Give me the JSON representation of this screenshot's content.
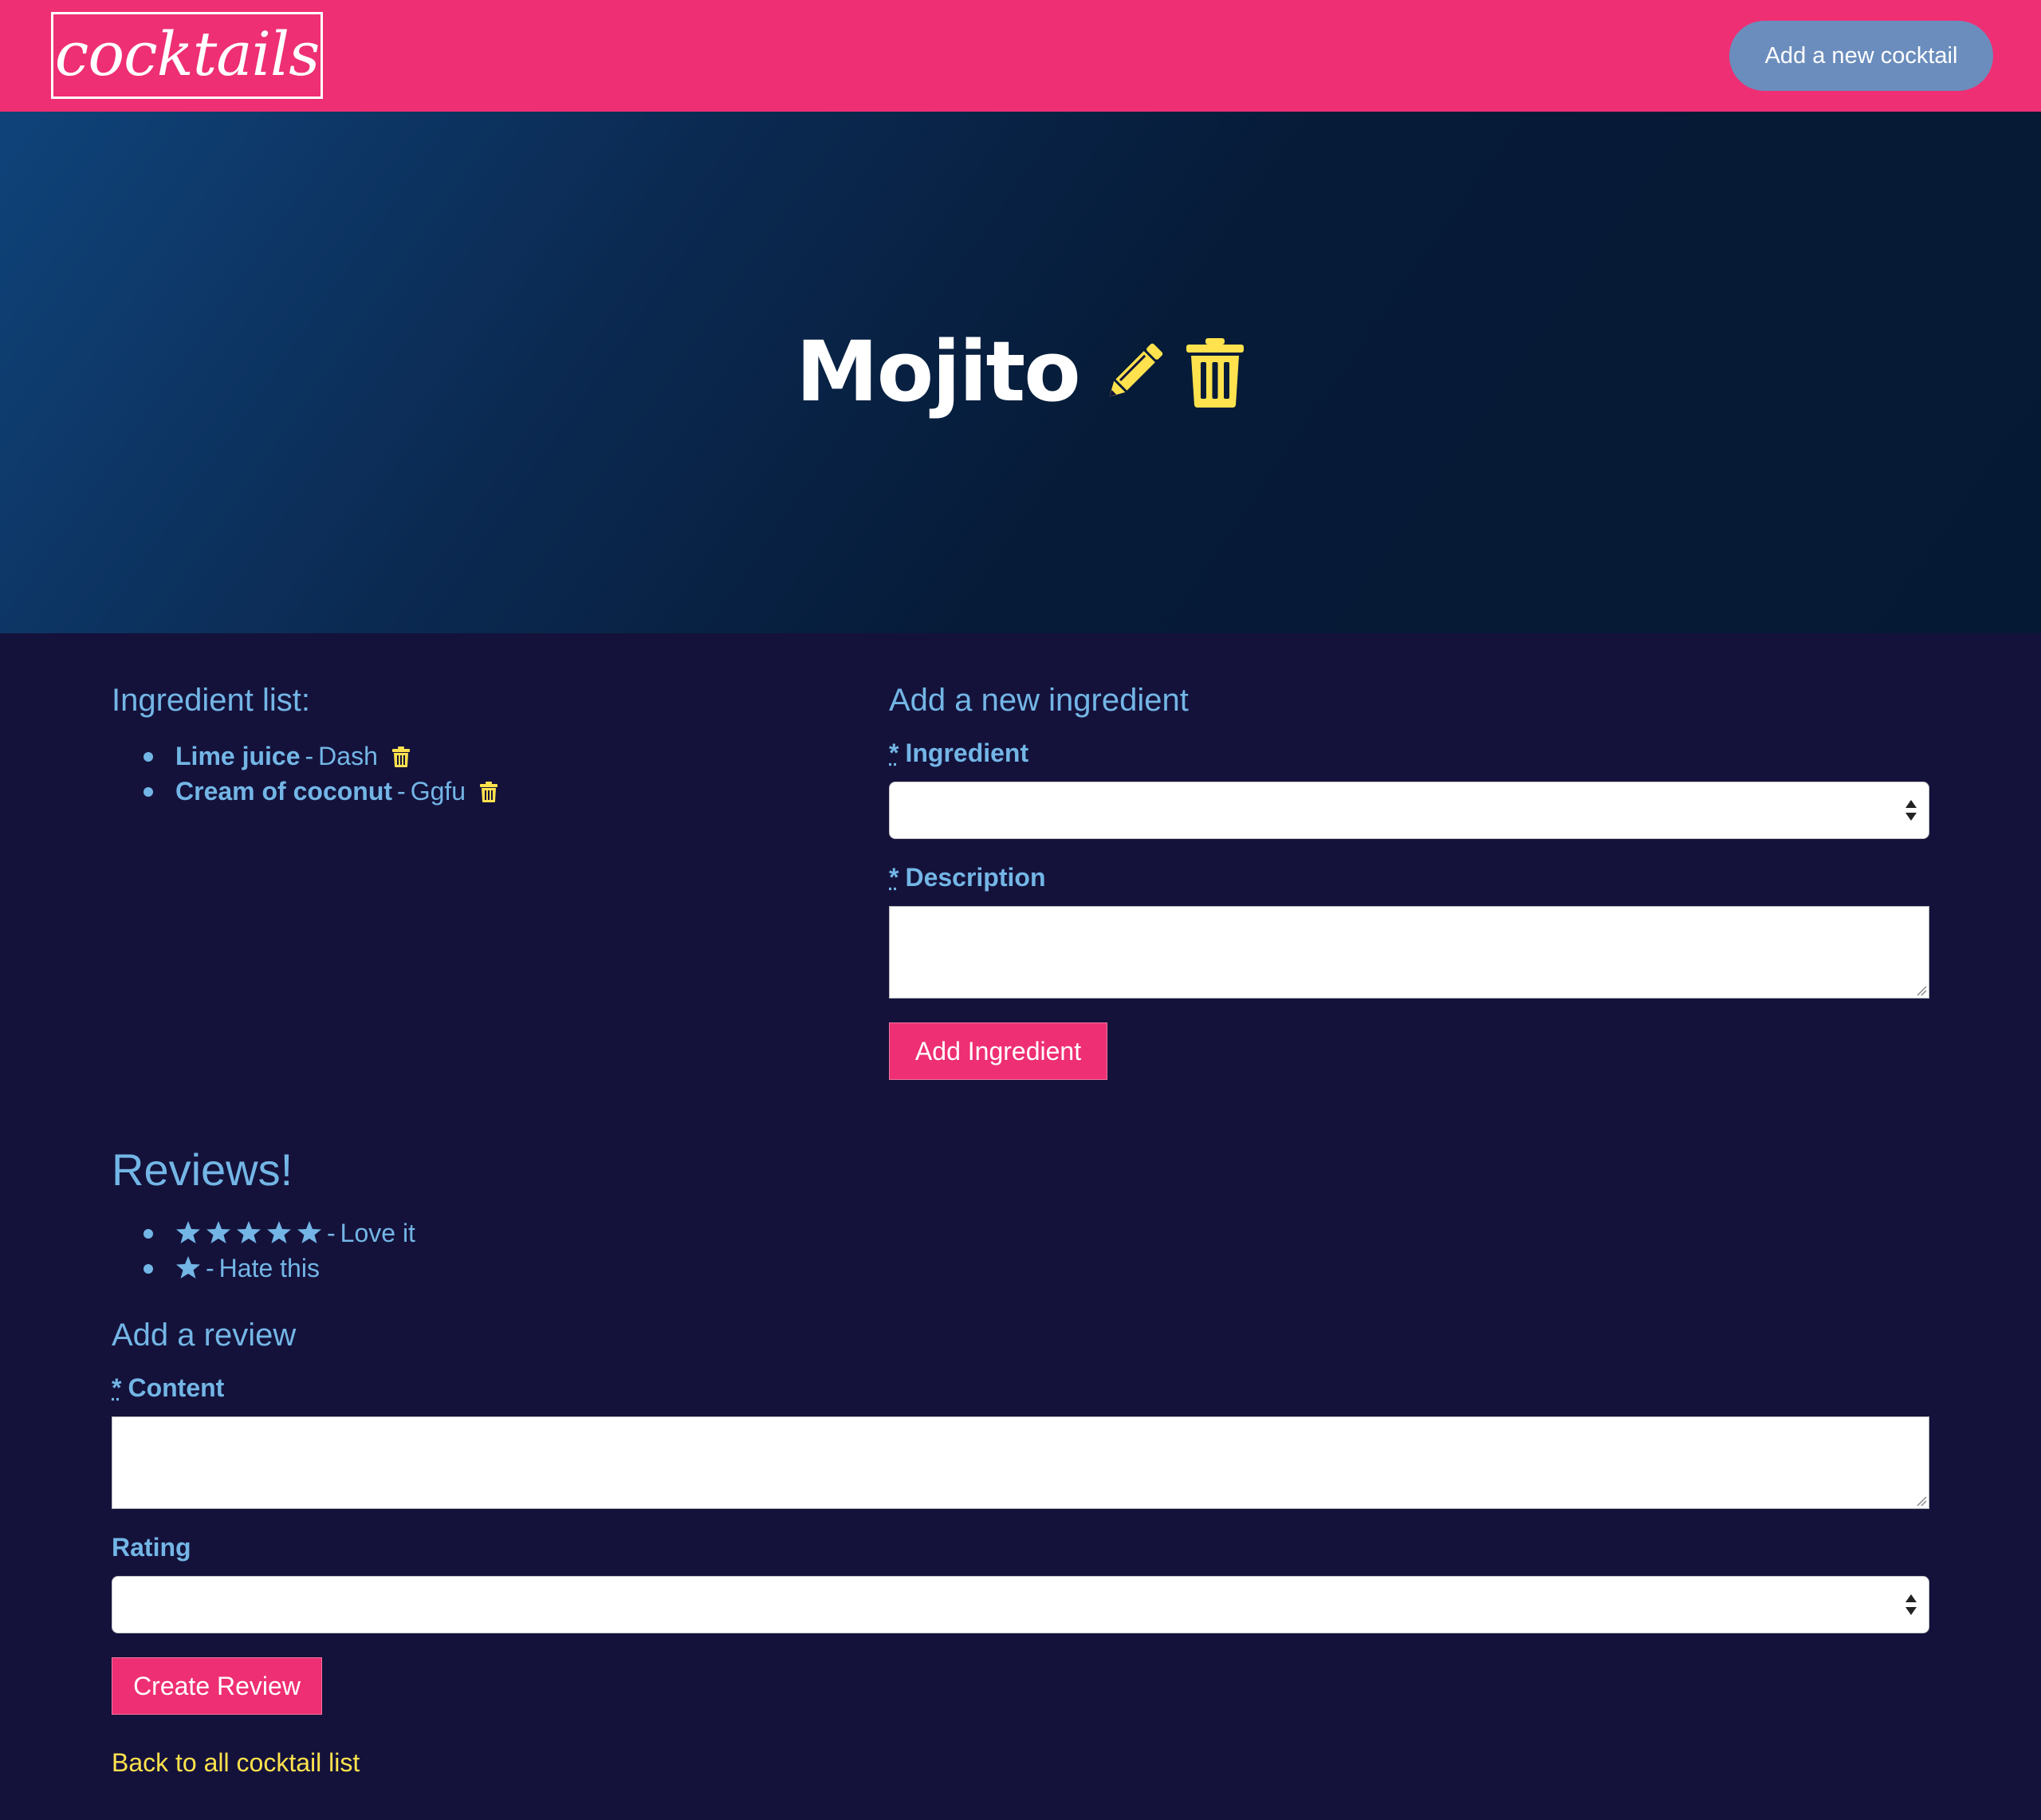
{
  "navbar": {
    "logo_text": "cocktails",
    "add_cocktail_label": "Add a new cocktail",
    "background_color": "#ee2f73"
  },
  "cocktail": {
    "name": "Mojito",
    "edit_icon": "pencil-icon",
    "delete_icon": "trash-icon"
  },
  "ingredients": {
    "heading": "Ingredient list:",
    "items": [
      {
        "name": "Lime juice",
        "description": "Dash"
      },
      {
        "name": "Cream of coconut",
        "description": "Ggfu"
      }
    ]
  },
  "add_ingredient_form": {
    "heading": "Add a new ingredient",
    "required_marker": "*",
    "ingredient_label": "Ingredient",
    "ingredient_value": "",
    "description_label": "Description",
    "description_value": "",
    "submit_label": "Add Ingredient"
  },
  "reviews": {
    "heading": "Reviews!",
    "items": [
      {
        "stars": 5,
        "content": "Love it"
      },
      {
        "stars": 1,
        "content": "Hate this"
      }
    ]
  },
  "add_review_form": {
    "heading": "Add a review",
    "required_marker": "*",
    "content_label": "Content",
    "content_value": "",
    "rating_label": "Rating",
    "rating_value": "",
    "submit_label": "Create Review"
  },
  "footer": {
    "back_link_label": "Back to all cocktail list"
  },
  "colors": {
    "accent_pink": "#ee2f73",
    "text_blue": "#73b6e6",
    "icon_yellow": "#ffe24d",
    "page_background": "#14123b",
    "nav_button": "#6b8dbd"
  }
}
